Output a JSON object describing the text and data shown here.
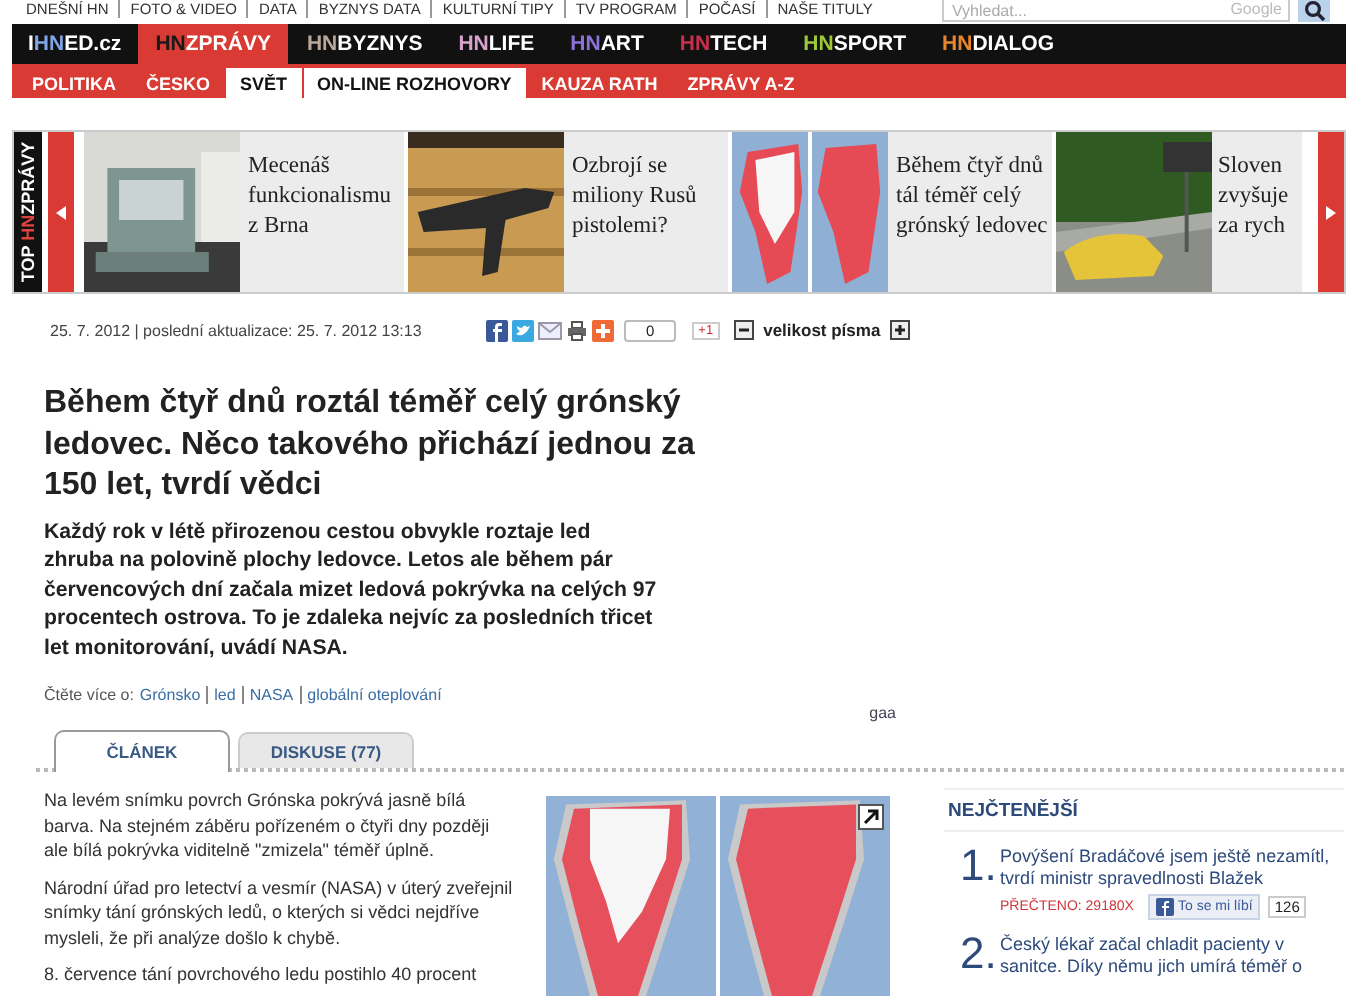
{
  "top_links": [
    "DNEŠNÍ HN",
    "FOTO & VIDEO",
    "DATA",
    "BYZNYS DATA",
    "KULTURNÍ TIPY",
    "TV PROGRAM",
    "POČASÍ",
    "NAŠE TITULY"
  ],
  "search": {
    "placeholder": "Vyhledat...",
    "provider": "Google"
  },
  "logo": {
    "parts": [
      "I",
      "HN",
      "ED.cz"
    ]
  },
  "sections": [
    {
      "prefix": "HN",
      "label": "ZPRÁVY",
      "color": "#1a1a1a",
      "selected": true
    },
    {
      "prefix": "HN",
      "label": "BYZNYS",
      "color": "#b9a99a",
      "selected": false
    },
    {
      "prefix": "HN",
      "label": "LIFE",
      "color": "#d8a2cc",
      "selected": false
    },
    {
      "prefix": "HN",
      "label": "ART",
      "color": "#8b72d8",
      "selected": false
    },
    {
      "prefix": "HN",
      "label": "TECH",
      "color": "#c7304c",
      "selected": false
    },
    {
      "prefix": "HN",
      "label": "SPORT",
      "color": "#9bc93a",
      "selected": false
    },
    {
      "prefix": "HN",
      "label": "DIALOG",
      "color": "#e8862c",
      "selected": false
    }
  ],
  "subsections": [
    {
      "label": "POLITIKA",
      "selected": false
    },
    {
      "label": "ČESKO",
      "selected": false
    },
    {
      "label": "SVĚT",
      "selected": true
    },
    {
      "label": "ON-LINE ROZHOVORY",
      "selected": true
    },
    {
      "label": "KAUZA RATH",
      "selected": false
    },
    {
      "label": "ZPRÁVY A-Z",
      "selected": false
    }
  ],
  "carousel": {
    "label_parts": [
      "TOP ",
      "HN",
      "ZPRÁVY"
    ],
    "items": [
      {
        "title": "Mecenáš funkcionalismu z Brna"
      },
      {
        "title": "Ozbrojí se miliony Rusů pistolemi?"
      },
      {
        "title": "Během čtyř dnů tál téměř celý grónský ledovec"
      },
      {
        "title": "Sloven zvyšuje za rych"
      }
    ]
  },
  "article": {
    "date": "25. 7. 2012 | poslední aktualizace: 25. 7. 2012  13:13",
    "share_count": "0",
    "plus_one": "+1",
    "font_size_label": "velikost písma",
    "title": "Během čtyř dnů roztál téměř celý grónský ledovec. Něco takového přichází jednou za 150 let, tvrdí vědci",
    "lead": "Každý rok v létě přirozenou cestou obvykle roztaje led zhruba na polovině plochy ledovce. Letos ale během pár červencových dní začala mizet ledová pokrývka na celých 97 procentech ostrova. To je zdaleka nejvíc za posledních třicet let monitorování, uvádí NASA.",
    "tags_label": "Čtěte více o:",
    "tags": [
      "Grónsko",
      "led",
      "NASA",
      "globální oteplování"
    ],
    "note": "gaa",
    "tabs": [
      {
        "label": "ČLÁNEK",
        "selected": true
      },
      {
        "label": "DISKUSE (77)",
        "selected": false
      }
    ],
    "paragraphs": [
      "Na levém snímku povrch Grónska pokrývá jasně bílá barva. Na stejném záběru pořízeném o čtyři dny později ale bílá pokrývka viditelně \"zmizela\" téměř úplně.",
      "Národní úřad pro letectví a vesmír (NASA) v úterý zveřejnil snímky tání grónských ledů, o kterých si vědci nejdříve mysleli, že při analýze došlo k chybě.",
      "8. července tání povrchového ledu postihlo 40 procent"
    ]
  },
  "most_read": {
    "title": "NEJČTENĚJŠÍ",
    "items": [
      {
        "rank": "1.",
        "title": "Povýšení Bradáčové jsem ještě nezamítl, tvrdí ministr spravedlnosti Blažek",
        "reads": "PŘEČTENO: 29180X",
        "like": "To se mi líbí",
        "likes": "126"
      },
      {
        "rank": "2.",
        "title": "Český lékař začal chladit pacienty v sanitce. Díky němu jich umírá téměř o"
      }
    ]
  }
}
